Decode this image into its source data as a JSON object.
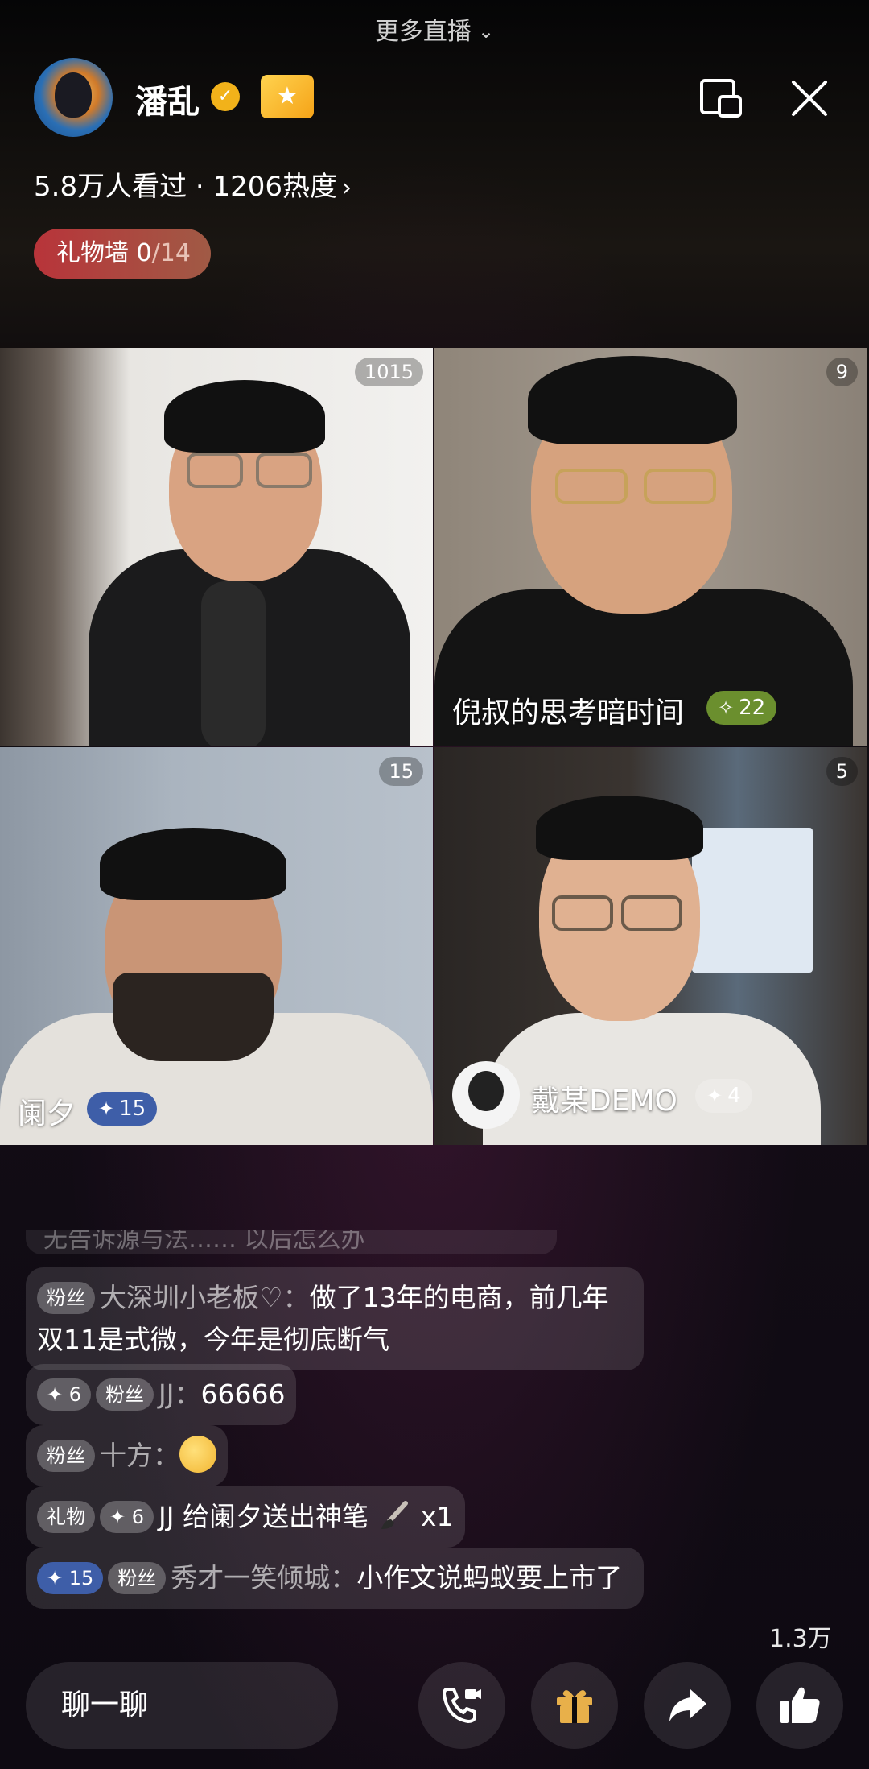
{
  "top": {
    "more_live": "更多直播"
  },
  "host": {
    "name": "潘乱",
    "stats": "5.8万人看过 · 1206热度",
    "gift_wall_label": "礼物墙 0",
    "gift_wall_total": "/14"
  },
  "tiles": [
    {
      "count": "1015",
      "caption": "",
      "badge": ""
    },
    {
      "count": "9",
      "caption": "倪叔的思考暗时间",
      "badge": "22"
    },
    {
      "count": "15",
      "caption": "阑夕",
      "badge": "15"
    },
    {
      "count": "5",
      "caption": "戴某DEMO",
      "badge": "4"
    }
  ],
  "chat": {
    "faded": "无告诉源与法…… 以后怎么办",
    "messages": [
      {
        "tags": [
          "粉丝"
        ],
        "user": "大深圳小老板♡",
        "text": "做了13年的电商，前几年双11是式微，今年是彻底断气"
      },
      {
        "tags": [
          "✦ 6",
          "粉丝"
        ],
        "user": "JJ",
        "text": "66666"
      },
      {
        "tags": [
          "粉丝"
        ],
        "user": "十方",
        "text": ""
      },
      {
        "tags": [
          "礼物",
          "✦ 6"
        ],
        "user": "",
        "text": "JJ 给阑夕送出神笔",
        "suffix": "x1"
      },
      {
        "tags": [
          "✦ 15",
          "粉丝"
        ],
        "user": "秀才一笑倾城",
        "text": "小作文说蚂蚁要上市了"
      }
    ]
  },
  "bottom": {
    "likes": "1.3万",
    "chat_placeholder": "聊一聊"
  },
  "colors": {
    "gift_wall": "#b8343a",
    "level_badge": "#f5a318",
    "verified": "#f2b21a",
    "pill_green": "#6b8f2e",
    "pill_blue": "#3e5ea8",
    "gift_icon": "#e8b04a"
  },
  "icons": {
    "more_live_chevron": "chevron-down-icon",
    "verified": "verified-icon",
    "level": "level-star-icon",
    "mini_window": "picture-in-picture-icon",
    "close": "close-icon",
    "video_call": "video-call-icon",
    "gift": "gift-icon",
    "share": "share-icon",
    "like": "thumbs-up-icon"
  }
}
